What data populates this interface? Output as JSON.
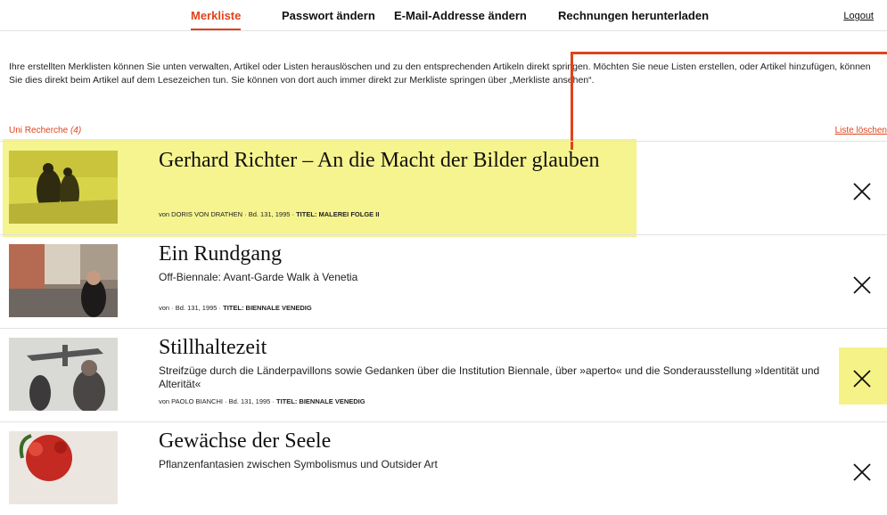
{
  "nav": {
    "tabs": [
      {
        "label": "Merkliste"
      },
      {
        "label": "Passwort ändern"
      },
      {
        "label": "E-Mail-Addresse ändern"
      },
      {
        "label": "Rechnungen herunterladen"
      }
    ],
    "logout": "Logout"
  },
  "intro": "Ihre erstellten Merklisten können Sie unten verwalten, Artikel oder Listen herauslöschen und zu den entsprechenden Artikeln direkt springen. Möchten Sie neue Listen erstellen, oder Artikel hinzufügen, können Sie dies direkt beim Artikel auf dem Lesezeichen tun. Sie können von dort auch immer direkt zur Merkliste springen über „Merkliste ansehen“.",
  "list": {
    "name": "Uni Recherche",
    "count": "(4)",
    "delete_label": "Liste löschen"
  },
  "items": [
    {
      "title": "Gerhard Richter – An die Macht der Bilder glauben",
      "subtitle": "",
      "meta_prefix": "von DORIS VON DRATHEN · Bd. 131, 1995 · ",
      "meta_bold": "TITEL: MALEREI FOLGE II"
    },
    {
      "title": "Ein Rundgang",
      "subtitle": "Off-Biennale: Avant-Garde Walk à Venetia",
      "meta_prefix": "von · Bd. 131, 1995 · ",
      "meta_bold": "TITEL: BIENNALE VENEDIG"
    },
    {
      "title": "Stillhaltezeit",
      "subtitle": "Streifzüge durch die Länderpavillons sowie Gedanken über die Institution Biennale, über »aperto« und die Sonderausstellung »Identität und Alterität«",
      "meta_prefix": "von PAOLO BIANCHI · Bd. 131, 1995 · ",
      "meta_bold": "TITEL: BIENNALE VENEDIG"
    },
    {
      "title": "Gewächse der Seele",
      "subtitle": "Pflanzenfantasien zwischen Symbolismus und Outsider Art",
      "meta_prefix": "",
      "meta_bold": ""
    }
  ],
  "colors": {
    "accent": "#e0431a",
    "highlight": "#f4f27a"
  }
}
